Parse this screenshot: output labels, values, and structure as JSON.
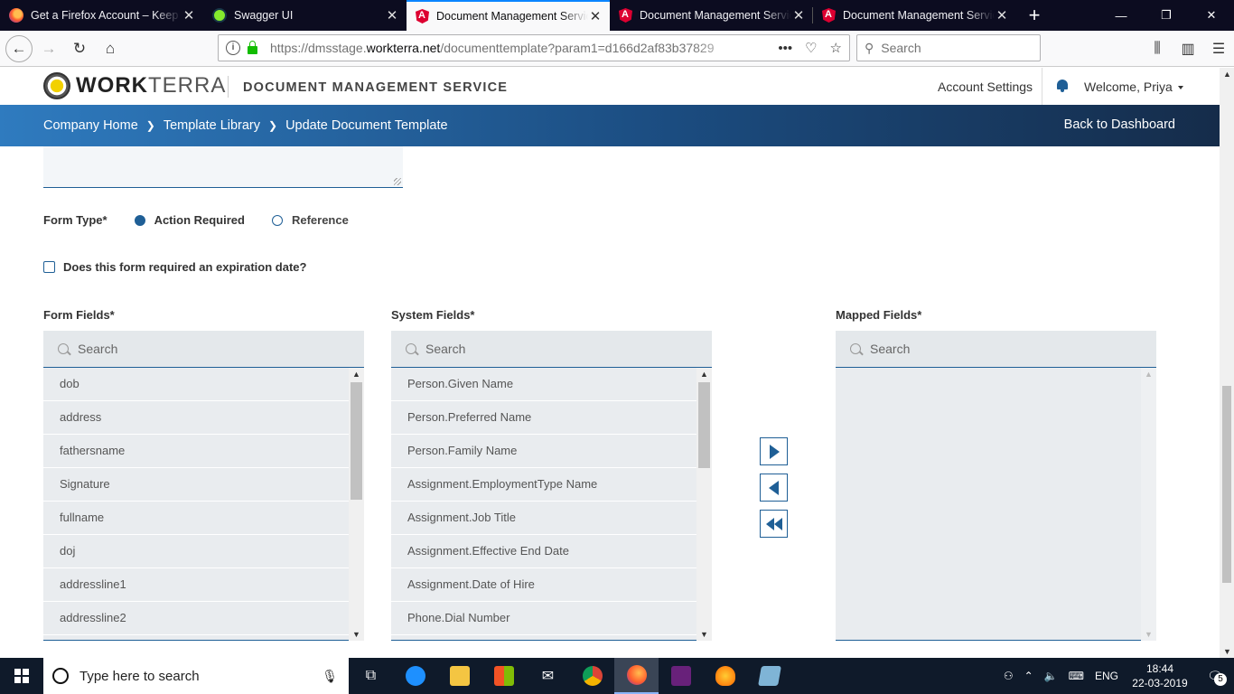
{
  "browser": {
    "tabs": [
      {
        "title": "Get a Firefox Account – Keep your data private",
        "icon": "firefox-icon",
        "active": false
      },
      {
        "title": "Swagger UI",
        "icon": "swagger-icon",
        "active": false
      },
      {
        "title": "Document Management Service",
        "icon": "angular-icon",
        "active": true
      },
      {
        "title": "Document Management Service",
        "icon": "angular-icon",
        "active": false
      },
      {
        "title": "Document Management Service",
        "icon": "angular-icon",
        "active": false
      }
    ],
    "url_prefix": "https://dmsstage.",
    "url_domain": "workterra.net",
    "url_path": "/documenttemplate?param1=d166d2af83b37829",
    "search_placeholder": "Search"
  },
  "app": {
    "logo_bold": "WORK",
    "logo_light": "TERRA",
    "title": "DOCUMENT MANAGEMENT SERVICE",
    "account_settings": "Account Settings",
    "welcome": "Welcome, Priya"
  },
  "breadcrumb": {
    "items": [
      "Company Home",
      "Template Library",
      "Update Document Template"
    ],
    "back": "Back to Dashboard"
  },
  "form": {
    "form_type_label": "Form Type*",
    "options": [
      {
        "label": "Action Required",
        "selected": true
      },
      {
        "label": "Reference",
        "selected": false
      }
    ],
    "expiration_label": "Does this form required an expiration date?",
    "expiration_checked": false
  },
  "panels": {
    "form_fields": {
      "label": "Form Fields*",
      "search_placeholder": "Search",
      "items": [
        "dob",
        "address",
        "fathersname",
        "Signature",
        "fullname",
        "doj",
        "addressline1",
        "addressline2"
      ]
    },
    "system_fields": {
      "label": "System Fields*",
      "search_placeholder": "Search",
      "items": [
        "Person.Given Name",
        "Person.Preferred Name",
        "Person.Family Name",
        "Assignment.EmploymentType Name",
        "Assignment.Job Title",
        "Assignment.Effective End Date",
        "Assignment.Date of Hire",
        "Phone.Dial Number"
      ]
    },
    "mapped_fields": {
      "label": "Mapped Fields*",
      "search_placeholder": "Search",
      "items": []
    }
  },
  "taskbar": {
    "search_placeholder": "Type here to search",
    "language": "ENG",
    "time": "18:44",
    "date": "22-03-2019",
    "notifications": "5"
  },
  "colors": {
    "primary": "#1f5f96",
    "band_start": "#2f7bbf",
    "band_end": "#152c4a",
    "panel_bg": "#e9ecef"
  }
}
